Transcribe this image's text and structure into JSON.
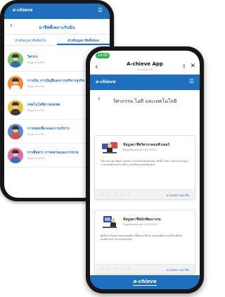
{
  "back_phone": {
    "brand": "a-chieve",
    "title": "อาชีพที่เหมาะกับฉัน",
    "tabs": [
      {
        "label": "ฝ่ายข้อมูลอาชีพที่สนใจ",
        "active": false
      },
      {
        "label": "ฝ่ายข้อมูลอาชีพทั้งหมด",
        "active": true
      }
    ],
    "items": [
      {
        "title": "วิศวกร",
        "subtitle": "ข้อมูล สาขาวิชา",
        "color": "#7fc36b"
      },
      {
        "title": "การเงิน การบัญชีและการบริหารธุรกิจ",
        "subtitle": "ข้อมูล สาขาวิชา",
        "color": "#f08a3a"
      },
      {
        "title": "เทคโนโลยีสารสนเทศ",
        "subtitle": "ข้อมูล สาขาวิชา",
        "color": "#e4c343"
      },
      {
        "title": "การท่องเที่ยวและการบริการ",
        "subtitle": "ข้อมูล สาขาวิชา",
        "color": "#5a86d6"
      },
      {
        "title": "การสื่อสาร การตลาดและการขาย",
        "subtitle": "ข้อมูล สาขาวิชา",
        "color": "#e86aa6"
      }
    ]
  },
  "front_phone": {
    "status_time": "14:00",
    "app_title": "A-chieve App",
    "app_url": "a-chieve.org",
    "brand": "a-chieve",
    "page_title": "วิศวกรรม ไอที และเทคโนโลยี",
    "cards": [
      {
        "title": "ข้อมูลอาชีพวิศวกรคอมพิวเตอร์",
        "date": "ข้อมูลอัพเดทล่าสุด 10/23/2022",
        "description": "วิจัย ออกแบบ พัฒนา ทดสอบ และกำหนดคุณลักษณะ ติดตั้ง บริหาร จัดการและดูแลระบบคอมพิวเตอร์รวมถึงระบบเครือข่ายคอมพิวเตอร์",
        "rating_stars": "☆ ☆ ☆ ☆ ☆",
        "read_more": "อ่านบทความอาชีพ"
      },
      {
        "title": "ข้อมูลอาชีพนักพัฒนาเกม",
        "date": "ข้อมูลอัพเดทล่าสุด 10/23/2022",
        "description": "ผู้ผลิตเกมในรูปแบบของซอฟต์แวร์ที่ทุกคนใช้เล่น ต่อยอดพัฒนาเกมทั้งบนมือถือ คอมพิวเตอร์ และเกมคอนโซล",
        "rating_stars": "☆ ☆ ☆ ☆ ☆",
        "read_more": "อ่านบทความอาชีพ"
      }
    ],
    "bottom_logo": "a-chieve"
  },
  "colors": {
    "brand_blue": "#1f6fbf",
    "time_green": "#2db34a"
  }
}
